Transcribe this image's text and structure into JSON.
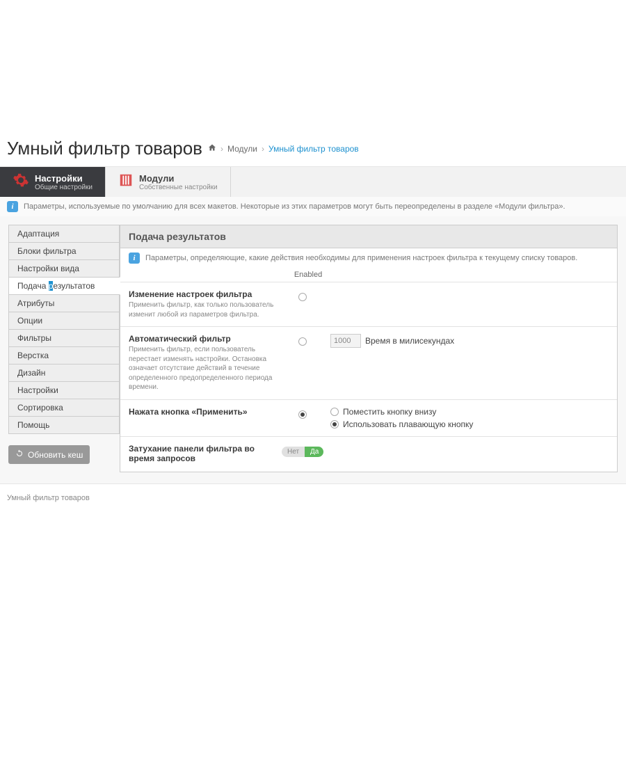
{
  "page_title": "Умный фильтр товаров",
  "breadcrumb": {
    "items": [
      "Модули",
      "Умный фильтр товаров"
    ]
  },
  "tabs": {
    "settings": {
      "title": "Настройки",
      "subtitle": "Общие настройки"
    },
    "modules": {
      "title": "Модули",
      "subtitle": "Собственные настройки"
    }
  },
  "info_top": "Параметры, используемые по умолчанию для всех макетов. Некоторые из этих параметров могут быть переопределены в разделе «Модули фильтра».",
  "sidebar": {
    "items": [
      "Адаптация",
      "Блоки фильтра",
      "Настройки вида",
      "Подача результатов",
      "Атрибуты",
      "Опции",
      "Фильтры",
      "Верстка",
      "Дизайн",
      "Настройки",
      "Сортировка",
      "Помощь"
    ],
    "active_index": 3,
    "active_pre": "Подача ",
    "active_hl": "р",
    "active_post": "езультатов",
    "refresh_label": "Обновить кеш"
  },
  "panel": {
    "header": "Подача результатов",
    "info": "Параметры, определяющие, какие действия необходимы для применения настроек фильтра к текущему списку товаров.",
    "enabled_label": "Enabled",
    "rows": [
      {
        "title": "Изменение настроек фильтра",
        "desc": "Применить фильтр, как только пользователь изменит любой из параметров фильтра."
      },
      {
        "title": "Автоматический фильтр",
        "desc": "Применить фильтр, если пользователь перестает изменять настройки. Остановка означает отсутствие действий в течение определенного предопределенного периода времени.",
        "ms_value": "1000",
        "ms_label": "Время в милисекундах"
      },
      {
        "title": "Нажата кнопка «Применить»",
        "sub_options": [
          "Поместить кнопку внизу",
          "Использовать плавающую кнопку"
        ],
        "sub_selected": 1
      },
      {
        "title": "Затухание панели фильтра во время запросов",
        "toggle_off": "Нет",
        "toggle_on": "Да"
      }
    ]
  },
  "footer": "Умный фильтр товаров"
}
